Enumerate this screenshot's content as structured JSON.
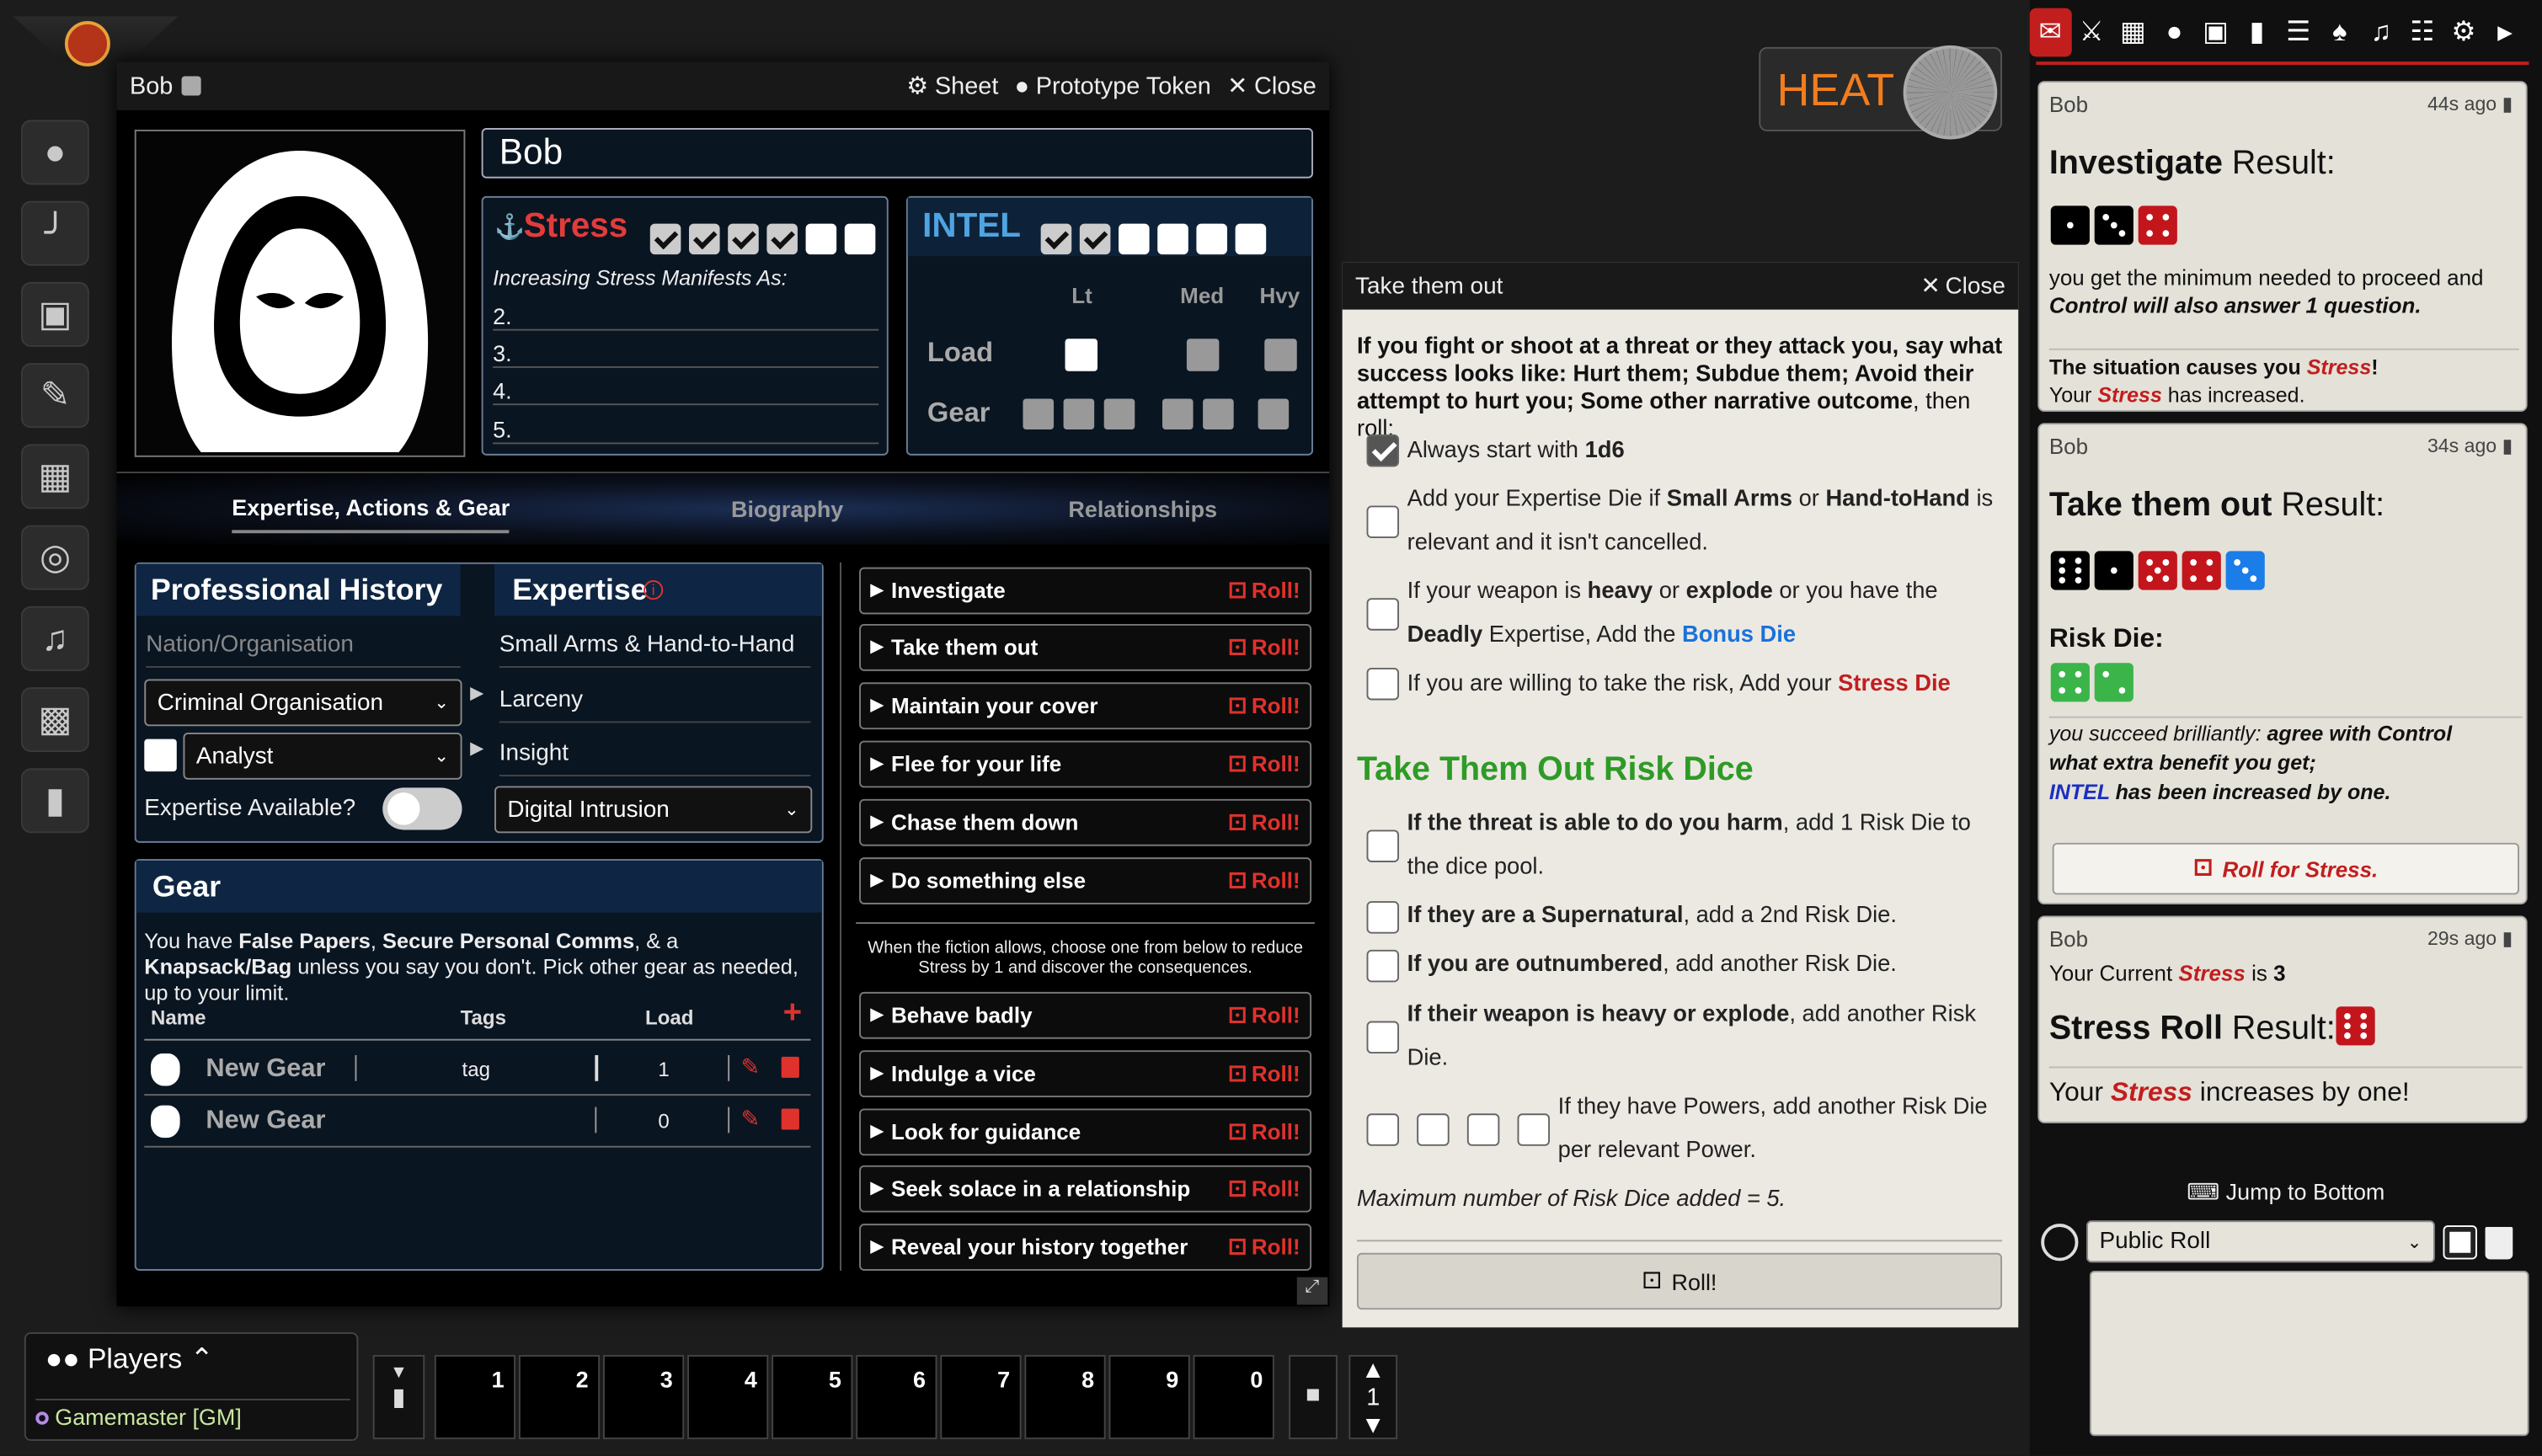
{
  "toolbar_left": {
    "logo": "d20-logo-icon",
    "tools": [
      "token-controls-icon",
      "measure-icon",
      "tiles-icon",
      "draw-icon",
      "walls-icon",
      "lighting-icon",
      "sound-icon",
      "regions-icon",
      "notes-icon"
    ]
  },
  "sheet": {
    "window_title": "Bob",
    "sheet_label": "Sheet",
    "prototype_label": "Prototype Token",
    "close_label": "Close",
    "name": "Bob",
    "stress_label": "Stress",
    "stress_boxes": [
      true,
      true,
      true,
      true,
      false,
      false
    ],
    "stress_manifest_label": "Increasing Stress Manifests As:",
    "manifest_numbers": [
      "2.",
      "3.",
      "4.",
      "5."
    ],
    "intel_label": "INTEL",
    "intel_boxes": [
      true,
      true,
      false,
      false,
      false,
      false
    ],
    "load_headers": [
      "Lt",
      "Med",
      "Hvy"
    ],
    "load_label": "Load",
    "gear_label": "Gear",
    "tabs": [
      "Expertise, Actions & Gear",
      "Biography",
      "Relationships"
    ],
    "prof_history_title": "Professional History",
    "nation_placeholder": "Nation/Organisation",
    "organisation_value": "Criminal Organisation",
    "role_value": "Analyst",
    "expertise_available_label": "Expertise Available?",
    "expertise_title": "Expertise",
    "expertise_items": [
      "Small Arms & Hand-to-Hand",
      "Larceny",
      "Insight",
      "Digital Intrusion"
    ],
    "gear_title": "Gear",
    "gear_text_pre": "You have ",
    "gear_text_b1": "False Papers",
    "gear_text_mid1": ", ",
    "gear_text_b2": "Secure Personal Comms",
    "gear_text_mid2": ", & a ",
    "gear_text_b3": "Knapsack/Bag",
    "gear_text_post": " unless you say you don't. Pick other gear as needed, up to your limit.",
    "gear_columns": [
      "Name",
      "Tags",
      "Load"
    ],
    "gear_add": "+",
    "gear_rows": [
      {
        "name": "New Gear",
        "tags": "tag",
        "load": "1"
      },
      {
        "name": "New Gear",
        "tags": "",
        "load": "0"
      }
    ],
    "actions": [
      "Investigate",
      "Take them out",
      "Maintain your cover",
      "Flee for your life",
      "Chase them down",
      "Do something else"
    ],
    "roll_label": "Roll!",
    "reduce_note": "When the fiction allows, choose one from below to reduce Stress by 1 and discover the consequences.",
    "stress_actions": [
      "Behave badly",
      "Indulge a vice",
      "Look for guidance",
      "Seek solace in a relationship",
      "Reveal your history together"
    ]
  },
  "heat": {
    "label": "HEAT"
  },
  "dialog": {
    "title": "Take them out",
    "close_label": "Close",
    "intro_pre": "If you fight or shoot at a threat or they attack you, say what success looks like: Hurt them; Subdue them; Avoid their attempt to hurt you; Some other narrative outcome",
    "intro_post": ", then roll:",
    "always_pre": "Always start with ",
    "always_b": "1d6",
    "opt1_pre": "Add your Expertise Die if ",
    "opt1_b1": "Small Arms",
    "opt1_mid": " or ",
    "opt1_b2": "Hand-toHand",
    "opt1_post": " is relevant and it isn't cancelled.",
    "opt2_pre": "If your weapon is ",
    "opt2_b1": "heavy",
    "opt2_mid": " or ",
    "opt2_b2": "explode",
    "opt2_mid2": " or you have the ",
    "opt2_b3": "Deadly",
    "opt2_mid3": " Expertise, Add the ",
    "opt2_bonus": "Bonus Die",
    "opt3_pre": "If you are willing to take the risk, Add your ",
    "opt3_stress": "Stress Die",
    "risk_title": "Take Them Out Risk Dice",
    "risk1_b": "If the threat is able to do you harm",
    "risk1_post": ", add 1 Risk Die to the dice pool.",
    "risk2_b": "If they are a Supernatural",
    "risk2_post": ", add a 2nd Risk Die.",
    "risk3_b": "If you are outnumbered",
    "risk3_post": ", add another Risk Die.",
    "risk4_b": "If their weapon is heavy or explode",
    "risk4_post": ", add another Risk Die.",
    "risk5": "If they have Powers, add another Risk Die per relevant Power.",
    "max_note": "Maximum number of Risk Dice added = 5.",
    "roll_button": "Roll!"
  },
  "chat": {
    "tabs": [
      "chat-icon",
      "combat-icon",
      "scenes-icon",
      "actors-icon",
      "items-icon",
      "journal-icon",
      "tables-icon",
      "cards-icon",
      "playlists-icon",
      "compendium-icon",
      "settings-icon",
      "collapse-icon"
    ],
    "messages": [
      {
        "speaker": "Bob",
        "time": "44s ago",
        "title_b": "Investigate",
        "title_r": " Result:",
        "line1": "you get the minimum needed to proceed and",
        "line2": "Control will also answer 1 question.",
        "sit_pre": "The situation causes you ",
        "sit_stress": "Stress",
        "sit_post": "!",
        "your": "Your ",
        "stress": "Stress",
        "inc": " has increased."
      },
      {
        "speaker": "Bob",
        "time": "34s ago",
        "title_b": "Take them out",
        "title_r": " Result:",
        "risk_label": "Risk Die:",
        "succ_pre": "you succeed brilliantly: ",
        "succ_b": "agree with Control",
        "succ_2": "what extra benefit you get;",
        "succ_intel": "INTEL",
        "succ_3": " has been increased by one.",
        "roll_stress": "Roll for Stress."
      },
      {
        "speaker": "Bob",
        "time": "29s ago",
        "cur_pre": "Your Current ",
        "cur_stress": "Stress",
        "cur_is": " is ",
        "cur_val": "3",
        "title_b": "Stress Roll",
        "title_r": " Result:",
        "inc_pre": "Your ",
        "inc_stress": "Stress",
        "inc_post": " increases by one!"
      }
    ],
    "jump_label": "Jump to Bottom",
    "roll_mode": "Public Roll"
  },
  "players": {
    "title": "Players",
    "entries": [
      "Gamemaster [GM]"
    ]
  },
  "hotbar": {
    "slots": [
      "1",
      "2",
      "3",
      "4",
      "5",
      "6",
      "7",
      "8",
      "9",
      "0"
    ],
    "page": "1"
  }
}
